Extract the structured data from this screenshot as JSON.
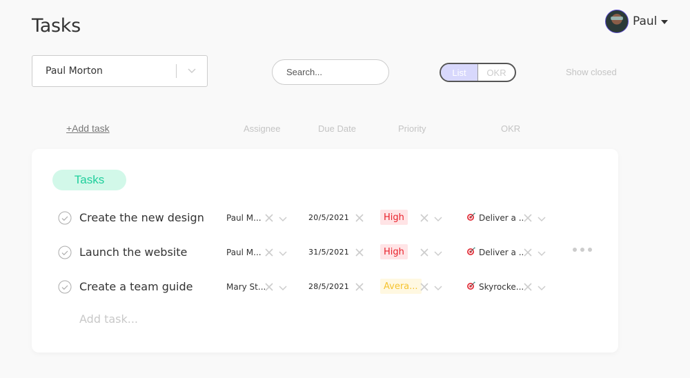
{
  "page": {
    "title": "Tasks"
  },
  "user": {
    "name": "Paul",
    "avatar_icon": "user-avatar"
  },
  "filters": {
    "assignee": "Paul Morton",
    "search_placeholder": "Search...",
    "view_options": [
      "List",
      "OKR"
    ],
    "active_view": "List",
    "show_closed": "Show closed"
  },
  "table": {
    "add_task_link": "+Add task",
    "columns": [
      "Assignee",
      "Due Date",
      "Priority",
      "OKR"
    ]
  },
  "group": {
    "label": "Tasks",
    "color": "#1fcf9c",
    "bg": "#d2f8e9",
    "tasks": [
      {
        "title": "Create the new design",
        "assignee": "Paul M...",
        "due_date": "20/5/2021",
        "priority": "High",
        "okr": "Deliver a .."
      },
      {
        "title": "Launch the website",
        "assignee": "Paul M...",
        "due_date": "31/5/2021",
        "priority": "High",
        "okr": "Deliver a .."
      },
      {
        "title": "Create a team guide",
        "assignee": "Mary St...",
        "due_date": "28/5/2021",
        "priority": "Avera...",
        "okr": "Skyrocke..."
      }
    ],
    "add_task_placeholder": "Add task..."
  },
  "priority_colors": {
    "High": {
      "text": "#e8202a",
      "bg": "#ffe4e6"
    },
    "Avera...": {
      "text": "#f5c330",
      "bg": "#fff8e1"
    }
  }
}
